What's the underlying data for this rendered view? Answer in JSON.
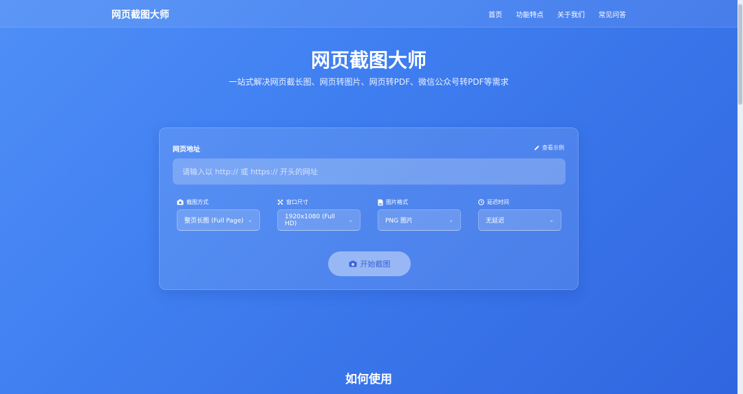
{
  "header": {
    "brand": "网页截图大师",
    "nav": [
      "首页",
      "功能特点",
      "关于我们",
      "常见问答"
    ]
  },
  "hero": {
    "title": "网页截图大师",
    "subtitle": "一站式解决网页截长图、网页转图片、网页转PDF、微信公众号转PDF等需求"
  },
  "form": {
    "url_label": "网页地址",
    "example_link": "查看示例",
    "url_placeholder": "请输入以 http:// 或 https:// 开头的网址",
    "url_value": "",
    "options": [
      {
        "label": "截图方式",
        "value": "整页长图 (Full Page)",
        "icon": "camera-icon"
      },
      {
        "label": "窗口尺寸",
        "value": "1920x1080 (Full HD)",
        "icon": "expand-icon"
      },
      {
        "label": "图片格式",
        "value": "PNG 图片",
        "icon": "image-file-icon"
      },
      {
        "label": "延迟时间",
        "value": "无延迟",
        "icon": "clock-icon"
      }
    ],
    "start_button": "开始截图"
  },
  "next_section": {
    "title": "如何使用"
  },
  "colors": {
    "background_start": "#4f8ff7",
    "background_end": "#3066e0",
    "button_text": "#3a63d6"
  }
}
